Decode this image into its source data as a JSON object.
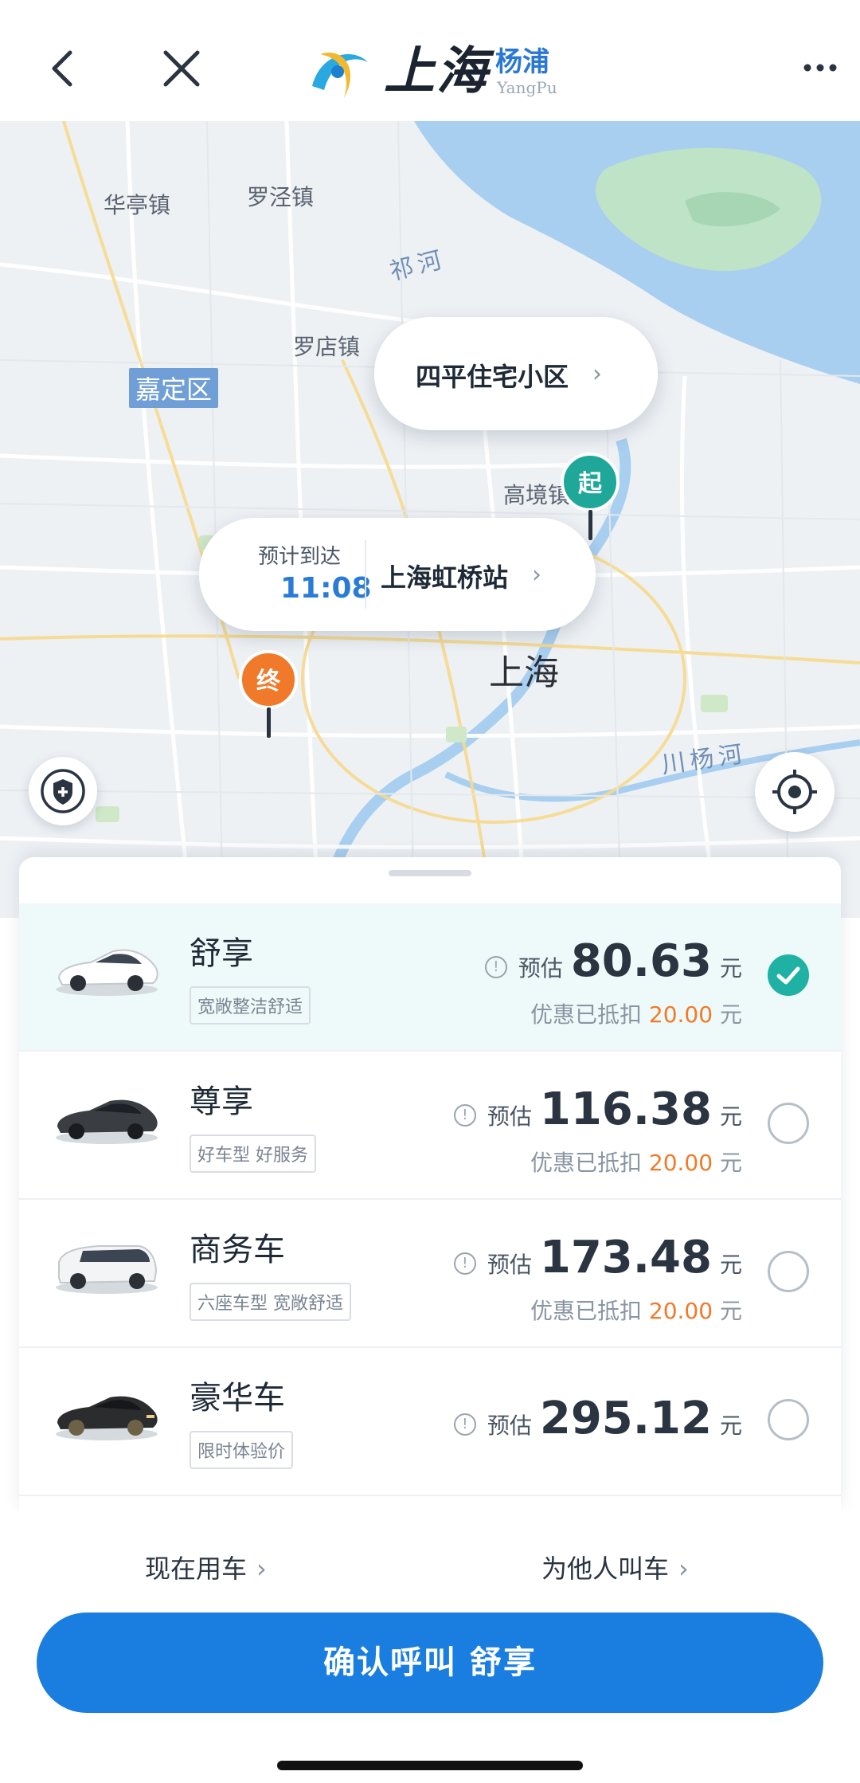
{
  "header": {
    "logo_main": "上海",
    "logo_sub": "杨浦",
    "logo_sub_en": "YangPu"
  },
  "map": {
    "labels": {
      "huating": "华亭镇",
      "luojing": "罗泾镇",
      "qihe": "祁河",
      "luodian": "罗店镇",
      "jiading": "嘉定区",
      "gaojing": "高境镇",
      "shanghai": "上海",
      "chuanyanghe": "川杨河"
    },
    "start_bubble": {
      "text": "四平住宅小区"
    },
    "end_bubble": {
      "eta_label": "预计到达",
      "eta_time": "11:08",
      "text": "上海虹桥站"
    },
    "start_pin": "起",
    "end_pin": "终"
  },
  "options": [
    {
      "name": "舒享",
      "tag": "宽敞整洁舒适",
      "est_label": "预估",
      "price": "80.63",
      "unit": "元",
      "discount_label": "优惠已抵扣",
      "discount": "20.00",
      "discount_unit": "元",
      "selected": true,
      "car_color": "#ffffff"
    },
    {
      "name": "尊享",
      "tag": "好车型 好服务",
      "est_label": "预估",
      "price": "116.38",
      "unit": "元",
      "discount_label": "优惠已抵扣",
      "discount": "20.00",
      "discount_unit": "元",
      "selected": false,
      "car_color": "#3a3d42"
    },
    {
      "name": "商务车",
      "tag": "六座车型 宽敞舒适",
      "est_label": "预估",
      "price": "173.48",
      "unit": "元",
      "discount_label": "优惠已抵扣",
      "discount": "20.00",
      "discount_unit": "元",
      "selected": false,
      "car_color": "#f3f4f6"
    },
    {
      "name": "豪华车",
      "tag": "限时体验价",
      "est_label": "预估",
      "price": "295.12",
      "unit": "元",
      "selected": false,
      "car_color": "#2a2c2e"
    }
  ],
  "bottom": {
    "now_label": "现在用车",
    "other_label": "为他人叫车",
    "confirm_label": "确认呼叫 舒享"
  },
  "colors": {
    "accent": "#1a7ee0",
    "teal": "#1fb2a4",
    "orange": "#f07a2a"
  },
  "icons": [
    "back-icon",
    "close-icon",
    "more-icon",
    "shield-plus-icon",
    "locate-icon",
    "check-icon",
    "info-icon"
  ]
}
